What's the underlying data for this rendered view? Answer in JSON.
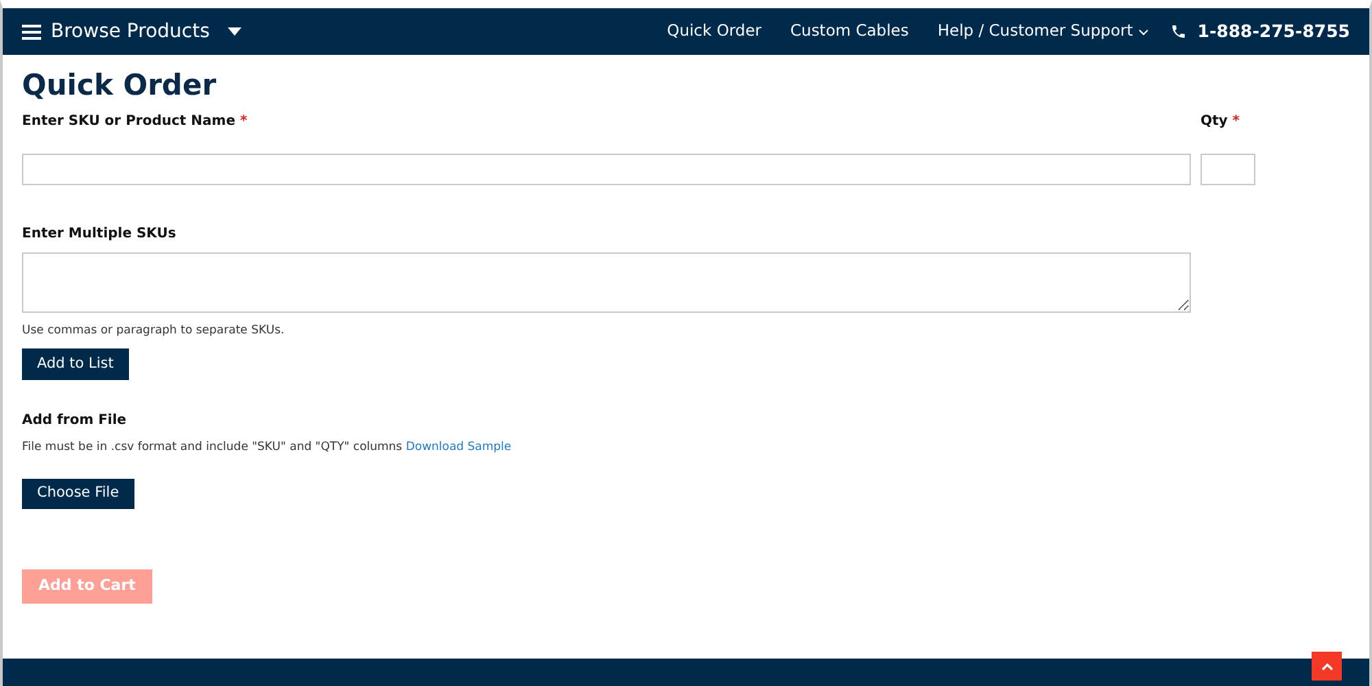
{
  "navbar": {
    "menu_label": "Browse Products",
    "links": [
      {
        "label": "Quick Order",
        "dropdown": false
      },
      {
        "label": "Custom Cables",
        "dropdown": false
      },
      {
        "label": "Help / Customer Support",
        "dropdown": true
      }
    ],
    "phone": "1-888-275-8755"
  },
  "title": "Quick Order",
  "sku_field": {
    "label": "Enter SKU or Product Name",
    "required_mark": "*"
  },
  "qty_field": {
    "label": "Qty",
    "required_mark": "*"
  },
  "multi_field": {
    "label": "Enter Multiple SKUs",
    "help": "Use commas or paragraph to separate SKUs."
  },
  "add_to_list": {
    "label": "Add to List"
  },
  "file_section": {
    "heading": "Add from File",
    "text": "File must be in .csv format and include \"SKU\" and \"QTY\" columns",
    "link": "Download Sample",
    "button": "Choose File"
  },
  "add_to_cart": {
    "label": "Add to Cart",
    "disabled": true
  }
}
